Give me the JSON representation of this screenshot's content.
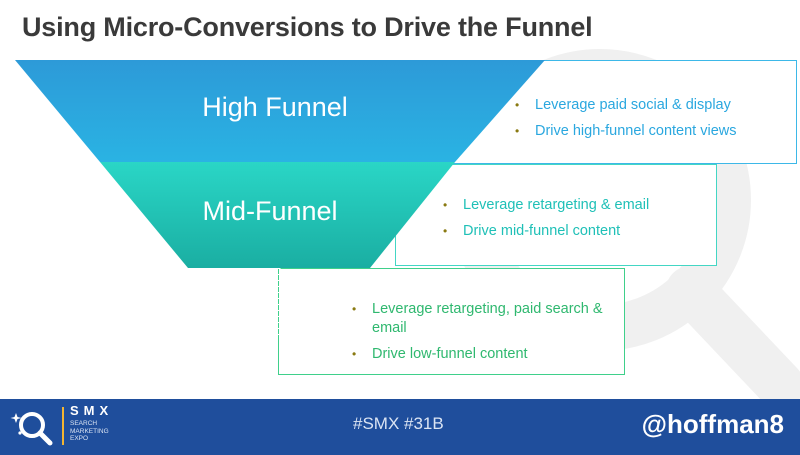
{
  "slide": {
    "title": "Using Micro-Conversions to Drive the Funnel"
  },
  "funnel": {
    "stages": [
      {
        "label": "High Funnel",
        "color": "#2ba3dd",
        "bullets": [
          "Leverage paid social & display",
          "Drive high-funnel content views"
        ]
      },
      {
        "label": "Mid-Funnel",
        "color": "#21c9b6",
        "bullets": [
          "Leverage retargeting & email",
          "Drive mid-funnel content"
        ]
      },
      {
        "label": "",
        "color": "#2fb86f",
        "bullets": [
          "Leverage retargeting, paid search & email",
          "Drive low-funnel content"
        ]
      }
    ],
    "bullet_color": "#8a7a12"
  },
  "footer": {
    "logo_title": "SMX",
    "logo_sub": [
      "SEARCH",
      "MARKETING",
      "EXPO"
    ],
    "hashtag": "#SMX #31B",
    "handle": "@hoffman8",
    "background_color": "#1f4e9c",
    "accent_color": "#f2b533"
  }
}
